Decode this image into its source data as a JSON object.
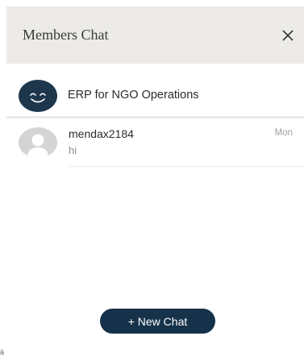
{
  "header": {
    "title": "Members Chat"
  },
  "group": {
    "name": "ERP for NGO Operations"
  },
  "chats": [
    {
      "name": "mendax2184",
      "message": "hi",
      "time": "Mon"
    }
  ],
  "actions": {
    "new_chat_label": "+ New Chat"
  },
  "icons": {
    "close": "close-icon",
    "group_avatar": "smiley-face-icon",
    "user_avatar": "user-silhouette-icon"
  },
  "colors": {
    "header_bg": "#ecebe7",
    "avatar_navy": "#1e364c",
    "button_navy": "#16324a",
    "avatar_gray": "#d4d4d4"
  }
}
